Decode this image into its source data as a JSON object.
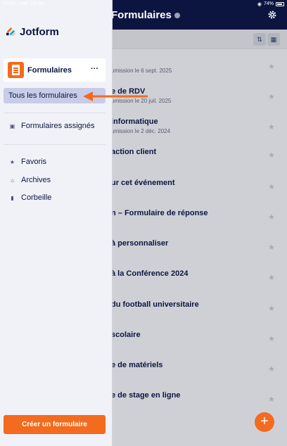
{
  "status_bar": {
    "time": "17:53",
    "date": "mer. 15 oct.",
    "battery": "74%"
  },
  "header": {
    "title": "Formulaires"
  },
  "toolbar": {
    "sort_icon": "sort-icon",
    "grid_icon": "grid-icon"
  },
  "forms": [
    {
      "title": "",
      "subtitle": "umission le 6 sept. 2025"
    },
    {
      "title": "e de RDV",
      "subtitle": "umission le 20 juil. 2025"
    },
    {
      "title": "informatique",
      "subtitle": "umission le 2 déc. 2024"
    },
    {
      "title": "action client",
      "subtitle": ""
    },
    {
      "title": "ur cet événement",
      "subtitle": ""
    },
    {
      "title": "n – Formulaire de réponse",
      "subtitle": ""
    },
    {
      "title": "à personnaliser",
      "subtitle": ""
    },
    {
      "title": "à la Conférence 2024",
      "subtitle": ""
    },
    {
      "title": "du football universitaire",
      "subtitle": ""
    },
    {
      "title": "scolaire",
      "subtitle": ""
    },
    {
      "title": "e de matériels",
      "subtitle": ""
    },
    {
      "title": "e de stage en ligne",
      "subtitle": ""
    }
  ],
  "drawer": {
    "brand": "Jotform",
    "section_label": "Formulaires",
    "more": "···",
    "all_forms": "Tous les formulaires",
    "assigned": "Formulaires assignés",
    "favorites": "Favoris",
    "archives": "Archives",
    "trash": "Corbeille",
    "create_button": "Créer un formulaire"
  },
  "fab_label": "+",
  "colors": {
    "accent": "#f26b1f",
    "navy": "#0c1540",
    "selected": "#c9cce8"
  }
}
